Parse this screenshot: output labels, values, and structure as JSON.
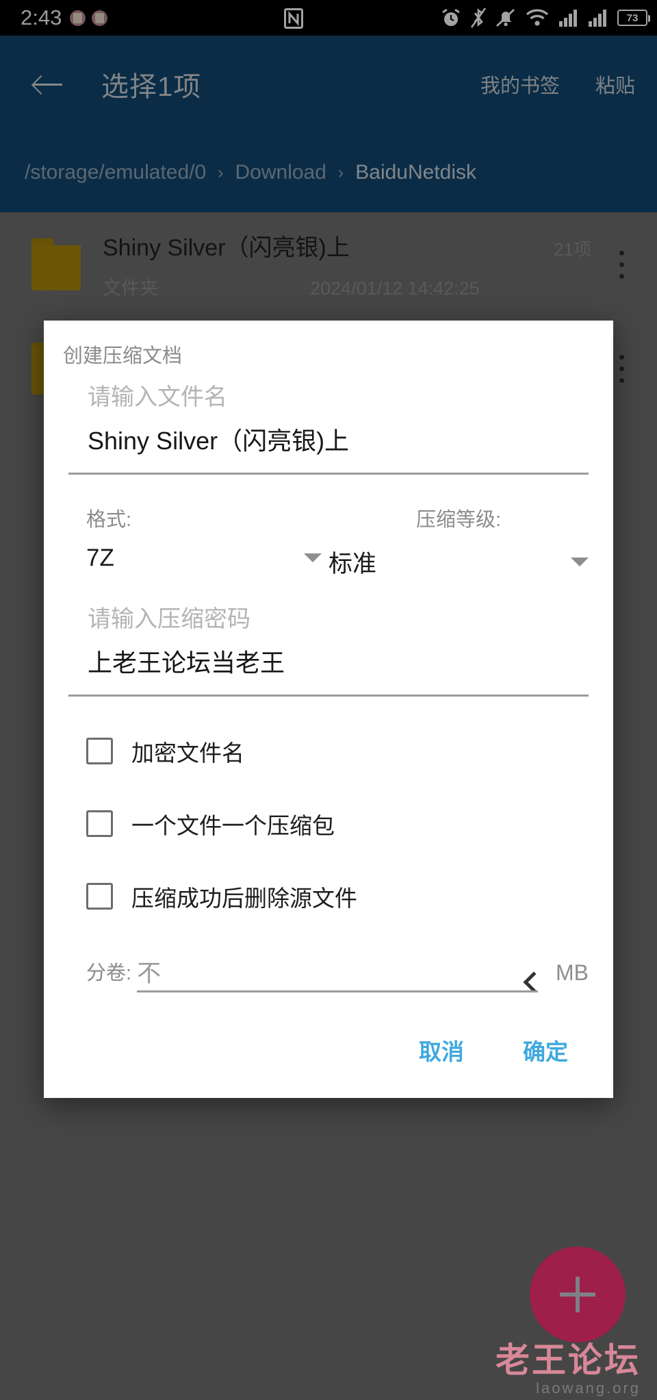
{
  "statusbar": {
    "clock": "2:43",
    "left_icons": [
      "app-badge-icon",
      "app-badge-icon"
    ],
    "right_icons": [
      "nfc-icon",
      "alarm-icon",
      "bluetooth-off-icon",
      "mute-bell-icon",
      "wifi-icon",
      "signal-icon",
      "signal-icon"
    ],
    "battery_percent": "73"
  },
  "appbar": {
    "back": "back-arrow-icon",
    "title": "选择1项",
    "actions": [
      "我的书签",
      "粘贴"
    ],
    "breadcrumb": {
      "separator": "›",
      "items": [
        "/storage/emulated/0",
        "Download",
        "BaiduNetdisk"
      ]
    },
    "background": "#12466e"
  },
  "filelist": {
    "rows": [
      {
        "icon": "folder-icon",
        "name": "Shiny Silver（闪亮银)上",
        "count": "21项",
        "type": "文件夹",
        "date": "2024/01/12 14:42:25",
        "menu": "overflow-menu-icon"
      }
    ]
  },
  "dialog": {
    "title": "创建压缩文档",
    "filename": {
      "placeholder": "请输入文件名",
      "value": "Shiny Silver（闪亮银)上"
    },
    "format": {
      "label": "格式:",
      "value": "7Z"
    },
    "level": {
      "label": "压缩等级:",
      "value": "标准"
    },
    "password": {
      "placeholder": "请输入压缩密码",
      "value": "上老王论坛当老王"
    },
    "checkboxes": [
      {
        "label": "加密文件名",
        "checked": false
      },
      {
        "label": "一个文件一个压缩包",
        "checked": false
      },
      {
        "label": "压缩成功后删除源文件",
        "checked": false
      }
    ],
    "split": {
      "label": "分卷:",
      "value": "不",
      "unit": "MB",
      "chevron": "chevron-left-icon"
    },
    "buttons": {
      "cancel": "取消",
      "confirm": "确定"
    },
    "accent": "#3fa9dd"
  },
  "fab": {
    "icon": "plus-icon",
    "color": "#9e1f49"
  },
  "watermark": {
    "main": "老王论坛",
    "sub": "laowang.org",
    "color": "#e58ea0"
  }
}
